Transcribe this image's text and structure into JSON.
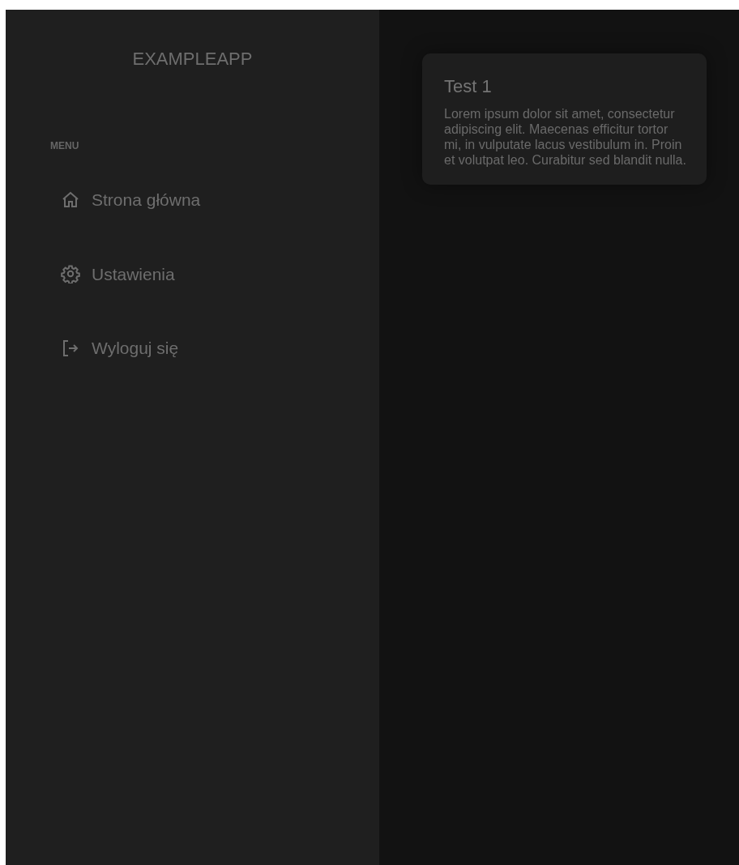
{
  "sidebar": {
    "app_name": "EXAMPLEAPP",
    "section_label": "MENU",
    "items": [
      {
        "kind": "home",
        "label": "Strona główna"
      },
      {
        "kind": "settings",
        "label": "Ustawienia"
      },
      {
        "kind": "logout",
        "label": "Wyloguj się"
      }
    ]
  },
  "cards": [
    {
      "title": "Test 1",
      "text": "Lorem ipsum dolor sit amet, consectetur adipiscing elit. Maecenas efficitur tortor mi, in vulputate lacus vestibulum in. Proin et volutpat leo. Curabitur sed blandit nulla."
    }
  ]
}
